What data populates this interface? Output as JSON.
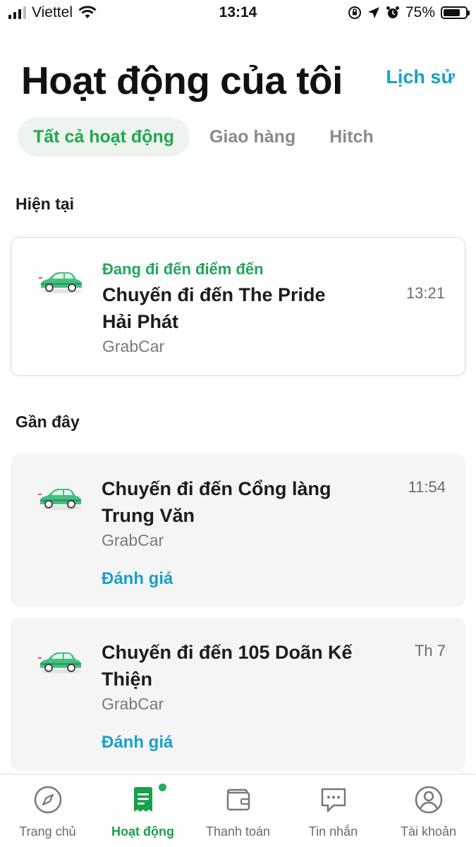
{
  "status_bar": {
    "carrier": "Viettel",
    "time": "13:14",
    "battery_percent_text": "75%",
    "battery_level": 0.75
  },
  "header": {
    "title": "Hoạt động của tôi",
    "history_link": "Lịch sử"
  },
  "filters": [
    {
      "label": "Tất cả hoạt động",
      "active": true
    },
    {
      "label": "Giao hàng",
      "active": false
    },
    {
      "label": "Hitch",
      "active": false
    }
  ],
  "current": {
    "section_title": "Hiện tại",
    "trip": {
      "status": "Đang đi đến điểm đến",
      "title": "Chuyến đi đến The Pride Hải Phát",
      "service": "GrabCar",
      "time": "13:21"
    }
  },
  "recent": {
    "section_title": "Gần đây",
    "trips": [
      {
        "title": "Chuyến đi đến Cổng làng Trung Văn",
        "service": "GrabCar",
        "time": "11:54",
        "action": "Đánh giá"
      },
      {
        "title": "Chuyến đi đến 105 Doãn Kế Thiện",
        "service": "GrabCar",
        "time": "Th 7",
        "action": "Đánh giá"
      }
    ]
  },
  "bottom_nav": [
    {
      "label": "Trang chủ",
      "icon": "compass-icon"
    },
    {
      "label": "Hoạt động",
      "icon": "activity-receipt-icon",
      "active": true
    },
    {
      "label": "Thanh toán",
      "icon": "wallet-icon"
    },
    {
      "label": "Tin nhắn",
      "icon": "chat-bubble-icon"
    },
    {
      "label": "Tài khoản",
      "icon": "account-icon"
    }
  ],
  "colors": {
    "brand_green": "#20a84e",
    "link_blue": "#1aa0c9",
    "status_green": "#22a65a"
  }
}
